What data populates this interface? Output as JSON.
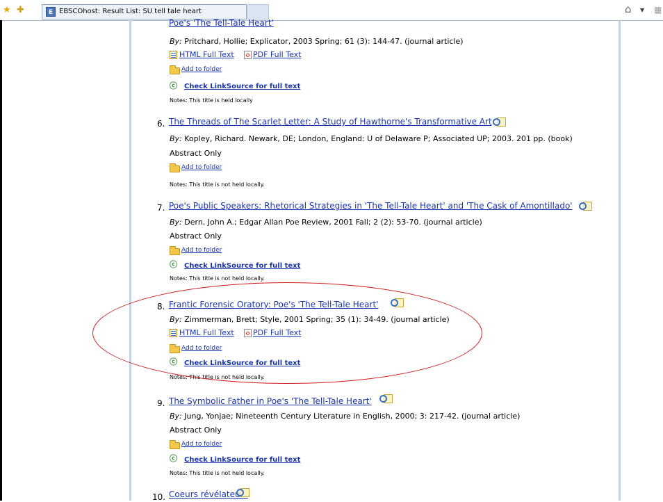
{
  "browser": {
    "tab_title": "EBSCOhost: Result List: SU tell tale heart",
    "tab_favicon": "E",
    "icons": [
      "favorites-star-icon",
      "add-favorites-icon",
      "home-icon",
      "feeds-icon"
    ]
  },
  "results": {
    "top_cut_title": "Poe's 'The Tell-Tale Heart'",
    "item5": {
      "byline_label": "By:",
      "byline": " Pritchard, Hollie; Explicator, 2003 Spring; 61 (3): 144-47. (journal article)",
      "html_full_text": "HTML Full Text",
      "pdf_full_text": "PDF Full Text",
      "add_to_folder": "Add to folder",
      "check_linksource": "Check LinkSource for full text",
      "notes": "Notes:   This title is held locally"
    },
    "item6": {
      "number": "6.",
      "title": "The Threads of The Scarlet Letter: A Study of Hawthorne's Transformative Art",
      "byline_label": "By:",
      "byline": " Kopley, Richard. Newark, DE; London, England: U of Delaware P; Associated UP; 2003. 201 pp. (book)",
      "abstract_only": "Abstract Only",
      "add_to_folder": "Add to folder",
      "notes": "Notes:   This title is not held locally."
    },
    "item7": {
      "number": "7.",
      "title": "Poe's Public Speakers: Rhetorical Strategies in 'The Tell-Tale Heart' and 'The Cask of Amontillado'",
      "byline_label": "By:",
      "byline": " Dern, John A.; Edgar Allan Poe Review, 2001 Fall; 2 (2): 53-70. (journal article)",
      "abstract_only": "Abstract Only",
      "add_to_folder": "Add to folder",
      "check_linksource": "Check LinkSource for full text",
      "notes": "Notes:   This title is not held locally."
    },
    "item8": {
      "number": "8.",
      "title": "Frantic Forensic Oratory: Poe's 'The Tell-Tale Heart'",
      "byline_label": "By:",
      "byline": " Zimmerman, Brett; Style, 2001 Spring; 35 (1): 34-49. (journal article)",
      "html_full_text": "HTML Full Text",
      "pdf_full_text": "PDF Full Text",
      "add_to_folder": "Add to folder",
      "check_linksource": "Check LinkSource for full text",
      "notes": "Notes:   This title is not held locally."
    },
    "item9": {
      "number": "9.",
      "title": "The Symbolic Father in Poe's 'The Tell-Tale Heart'",
      "byline_label": "By:",
      "byline": " Jung, Yonjae; Nineteenth Century Literature in English, 2000; 3: 217-42. (journal article)",
      "abstract_only": "Abstract Only",
      "add_to_folder": "Add to folder",
      "check_linksource": "Check LinkSource for full text",
      "notes": "Notes:   This title is not held locally."
    },
    "item10": {
      "number": "10.",
      "title": "Coeurs révélateurs"
    }
  },
  "annotation": {
    "color": "#d01818",
    "shape": "ellipse"
  }
}
